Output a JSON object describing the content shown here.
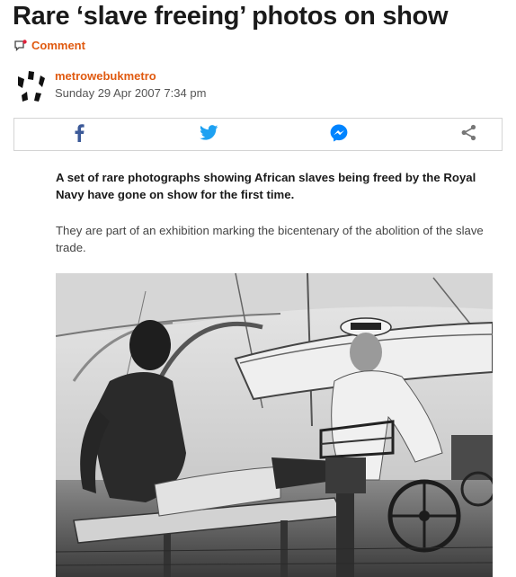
{
  "article": {
    "title": "Rare ‘slave freeing’ photos on show",
    "comment_label": "Comment",
    "author": "metrowebukmetro",
    "date": "Sunday 29 Apr 2007 7:34 pm",
    "lead": "A set of rare photographs showing African slaves being freed by the Royal Navy have gone on show for the first time.",
    "body": "They are part of an exhibition marking the bicentenary of the abolition of the slave trade."
  },
  "share": {
    "items": [
      {
        "name": "facebook",
        "icon": "facebook-icon",
        "color": "#3b5998"
      },
      {
        "name": "twitter",
        "icon": "twitter-icon",
        "color": "#1da1f2"
      },
      {
        "name": "messenger",
        "icon": "messenger-icon",
        "color": "#0084ff"
      },
      {
        "name": "share",
        "icon": "share-icon",
        "color": "#777777"
      }
    ]
  },
  "colors": {
    "accent": "#e05a10",
    "text": "#1a1a1a",
    "border": "#d4d4d4"
  },
  "image": {
    "description_icon": "black-and-white-photo"
  }
}
